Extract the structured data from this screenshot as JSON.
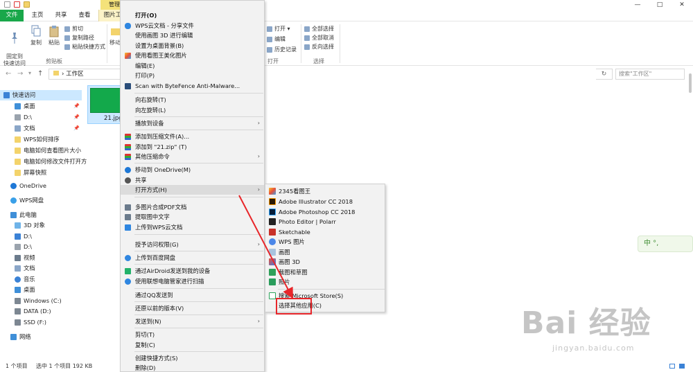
{
  "title_bar": {
    "context_tab": "管理",
    "min": "—",
    "max": "□",
    "close": "✕"
  },
  "tabs": [
    "文件",
    "主页",
    "共享",
    "查看",
    "图片工"
  ],
  "ribbon": {
    "pin_quick_access": "固定到\n快速访问",
    "copy": "复制",
    "paste": "粘贴",
    "cut": "剪切",
    "copy_path": "复制路径",
    "paste_shortcut": "粘贴快捷方式",
    "clipboard_group": "剪贴板",
    "move_to": "移动",
    "open": "打开 ▾",
    "edit": "编辑",
    "history": "历史记录",
    "open_group": "打开",
    "select_all": "全部选择",
    "select_none": "全部取消",
    "invert_selection": "反向选择",
    "select_group": "选择"
  },
  "address": {
    "back": "←",
    "forward": "→",
    "dropdown": "▾",
    "up": "↑",
    "path": "工作区",
    "refresh": "↻",
    "search_placeholder": "搜索\"工作区\""
  },
  "nav_pane": {
    "items": [
      {
        "label": "快速访问",
        "pinned": false
      },
      {
        "label": "桌面",
        "pinned": true
      },
      {
        "label": "D:\\",
        "pinned": true
      },
      {
        "label": "文档",
        "pinned": true
      },
      {
        "label": "WPS如何排序",
        "pinned": false
      },
      {
        "label": "电脑如何查看图片大小",
        "pinned": false
      },
      {
        "label": "电脑如何修改文件打开方",
        "pinned": false
      },
      {
        "label": "屏幕快照",
        "pinned": false
      },
      {
        "label": "OneDrive",
        "pinned": false
      },
      {
        "label": "WPS网盘",
        "pinned": false
      },
      {
        "label": "此电脑",
        "pinned": false
      },
      {
        "label": "3D 对象",
        "pinned": false
      },
      {
        "label": "D:\\",
        "pinned": false
      },
      {
        "label": "D:\\",
        "pinned": false
      },
      {
        "label": "视频",
        "pinned": false
      },
      {
        "label": "文档",
        "pinned": false
      },
      {
        "label": "音乐",
        "pinned": false
      },
      {
        "label": "桌面",
        "pinned": false
      },
      {
        "label": "Windows (C:)",
        "pinned": false
      },
      {
        "label": "DATA (D:)",
        "pinned": false
      },
      {
        "label": "SSD (F:)",
        "pinned": false
      },
      {
        "label": "网络",
        "pinned": false
      }
    ]
  },
  "file": {
    "name": "21.jpg",
    "thumb_color": "#13a94b"
  },
  "status_bar": {
    "count": "1 个项目",
    "selection": "选中 1 个项目  192 KB"
  },
  "context_menu": {
    "items": [
      "打开(O)",
      "WPS云文档 - 分享文件",
      "使用画图 3D 进行编辑",
      "设置为桌面背景(B)",
      "使用看图王美化图片",
      "编辑(E)",
      "打印(P)",
      "Scan with ByteFence Anti-Malware...",
      "向右旋转(T)",
      "向左旋转(L)",
      "播放到设备",
      "添加到压缩文件(A)...",
      "添加到 \"21.zip\" (T)",
      "其他压缩命令",
      "移动到 OneDrive(M)",
      "共享",
      "打开方式(H)",
      "多图片合成PDF文档",
      "提取图中文字",
      "上传到WPS云文档",
      "授予访问权限(G)",
      "上传到百度网盘",
      "通过AirDroid发送到我的设备",
      "使用联想电脑管家进行扫描",
      "通过QQ发送到",
      "还原以前的版本(V)",
      "发送到(N)",
      "剪切(T)",
      "复制(C)",
      "创建快捷方式(S)",
      "删除(D)"
    ],
    "arrow": "›"
  },
  "submenu": {
    "items": [
      "2345看图王",
      "Adobe Illustrator CC 2018",
      "Adobe Photoshop CC 2018",
      "Photo Editor | Polarr",
      "Sketchable",
      "WPS 图片",
      "画图",
      "画图 3D",
      "截图和草图",
      "照片",
      "搜索 Microsoft Store(S)",
      "选择其他应用(C)"
    ]
  },
  "ime_toolbar": "中 °,",
  "watermark": {
    "main": "Bai 经验",
    "url": "jingyan.baidu.com"
  },
  "accent_colors": {
    "file_tab": "#19a74a",
    "annotation": "#e8262a",
    "selection": "#cce8ff"
  }
}
